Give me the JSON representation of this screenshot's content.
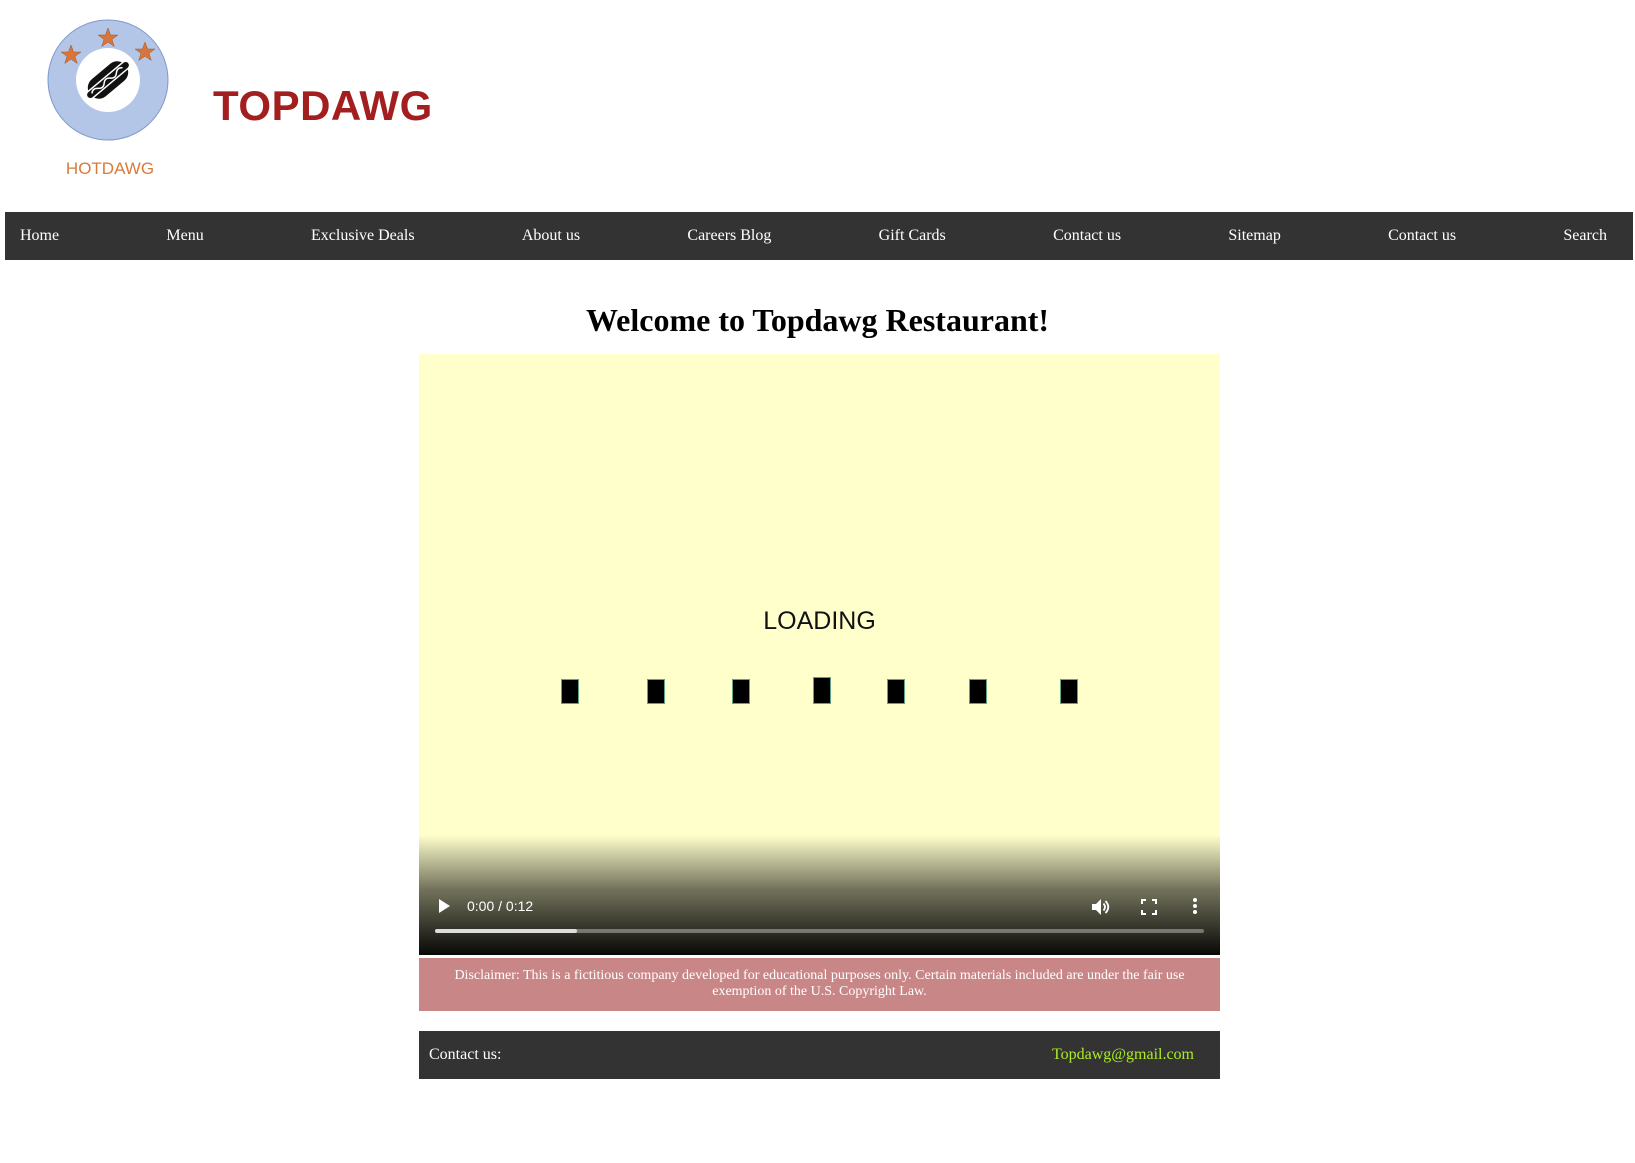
{
  "header": {
    "logo_text": "HOTDAWG",
    "title": "TOPDAWG",
    "title_color": "#a31f1f",
    "logo_text_color": "#d97a3a",
    "logo_ring_color": "#b3c6e8",
    "logo_star_color": "#d9743a"
  },
  "nav": {
    "items": [
      "Home",
      "Menu",
      "Exclusive Deals",
      "About us",
      "Careers Blog",
      "Gift Cards",
      "Contact us",
      "Sitemap",
      "Contact us",
      "Search"
    ]
  },
  "main": {
    "heading": "Welcome to Topdawg Restaurant!",
    "video": {
      "background_color": "#ffffcc",
      "loading_text": "LOADING",
      "time_display": "0:00 / 0:12",
      "buffered_fraction": 0.185,
      "icons": [
        "play-icon",
        "volume-icon",
        "fullscreen-icon",
        "more-options-icon"
      ]
    },
    "disclaimer": "Disclaimer: This is a fictitious company developed for educational purposes only. Certain materials included are under the fair use exemption of the U.S. Copyright Law.",
    "disclaimer_bg": "#c98686"
  },
  "footer": {
    "label": "Contact us:",
    "email": "Topdawg@gmail.com",
    "email_color": "#aaee22"
  }
}
